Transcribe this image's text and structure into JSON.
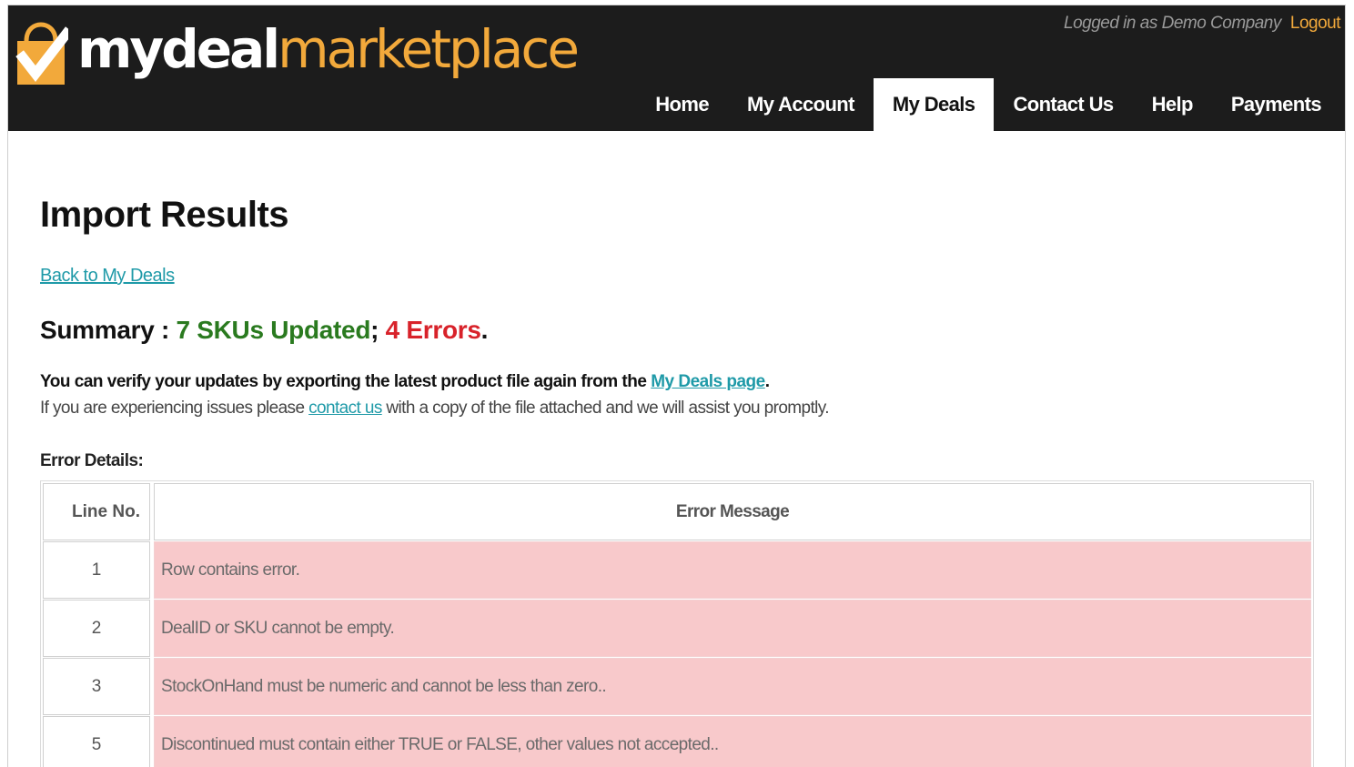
{
  "header": {
    "logo_my": "mydeal",
    "logo_marketplace": "marketplace",
    "logo_icon": "checkbox-bag-icon",
    "session_text": "Logged in as Demo Company",
    "logout_label": "Logout",
    "nav": [
      {
        "label": "Home",
        "active": false
      },
      {
        "label": "My Account",
        "active": false
      },
      {
        "label": "My Deals",
        "active": true
      },
      {
        "label": "Contact Us",
        "active": false
      },
      {
        "label": "Help",
        "active": false
      },
      {
        "label": "Payments",
        "active": false
      }
    ]
  },
  "page": {
    "title": "Import Results",
    "back_link": "Back to My Deals",
    "summary": {
      "prefix": "Summary : ",
      "updated": "7 SKUs Updated",
      "separator": "; ",
      "errors": "4 Errors",
      "suffix": "."
    },
    "info1": {
      "text": "You can verify your updates by exporting the latest product file again from the ",
      "link": "My Deals page",
      "suffix": "."
    },
    "info2": {
      "prefix": "If you are experiencing issues please ",
      "link": "contact us",
      "suffix": " with a copy of the file attached and we will assist you promptly."
    },
    "error_details_label": "Error Details:"
  },
  "table": {
    "headers": {
      "line": "Line No.",
      "message": "Error Message"
    },
    "rows": [
      {
        "line": "1",
        "message": "Row contains error."
      },
      {
        "line": "2",
        "message": "DealID or SKU cannot be empty."
      },
      {
        "line": "3",
        "message": "StockOnHand must be numeric and cannot be less than zero.."
      },
      {
        "line": "5",
        "message": "Discontinued must contain either TRUE or FALSE, other values not accepted.."
      }
    ]
  },
  "colors": {
    "header_bg": "#1c1c1c",
    "brand_orange": "#f2a93b",
    "link": "#1f9aa8",
    "success": "#2a7a1f",
    "error": "#d8222a",
    "error_row_bg": "#f8c9cb"
  }
}
